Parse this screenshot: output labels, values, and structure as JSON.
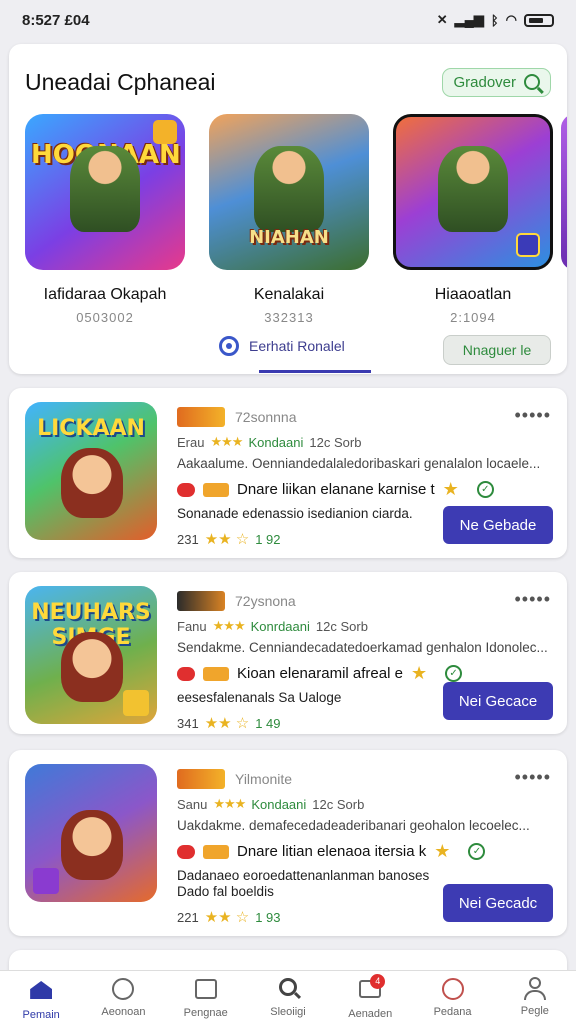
{
  "status": {
    "time": "8:527 £04"
  },
  "featured": {
    "title": "Uneadai Cphaneai",
    "discover_label": "Gradover",
    "items": [
      {
        "name": "Iafidaraa Okapah",
        "count": "0503002",
        "art_text": "HOONAAN"
      },
      {
        "name": "Kenalakai",
        "count": "332313",
        "art_text": "NIAHAN"
      },
      {
        "name": "Hiaaoatlan",
        "count": "2:1094",
        "art_text": ""
      }
    ],
    "footer_tab_label": "Eerhati Ronalel",
    "manage_label": "Nnaguer le"
  },
  "list": [
    {
      "art_text": "LICKAAN",
      "developer": "72sonnna",
      "row2_prefix": "Erau",
      "row2_stars": "★★★",
      "row2_category": "Kondaani",
      "row2_suffix": "12c Sorb",
      "description": "Aakaalume. Oenniandedalaledoribaskari genalalon locaele...",
      "feature_title": "Dnare liikan elanane karnise t",
      "description2": "Sonanade edenassio isedianion ciarda.",
      "rating_prefix": "231",
      "rating_stars": "★★ ☆",
      "rating_suffix": "1 92",
      "install_label": "Ne Gebade"
    },
    {
      "art_text": "NEUHARS SIMGE",
      "developer": "72ysnona",
      "row2_prefix": "Fanu",
      "row2_stars": "★★★",
      "row2_category": "Konrdaani",
      "row2_suffix": "12c Sorb",
      "description": "Sendakme. Cenniandecadatedoerkamad genhalon Idonolec...",
      "feature_title": "Kioan elenaramil afreal e",
      "description2": "eesesfalenanals Sa Ualoge",
      "rating_prefix": "341",
      "rating_stars": "★★ ☆",
      "rating_suffix": "1 49",
      "install_label": "Nei Gecace"
    },
    {
      "art_text": "",
      "developer": "Yilmonite",
      "row2_prefix": "Sanu",
      "row2_stars": "★★★",
      "row2_category": "Kondaani",
      "row2_suffix": "12c Sorb",
      "description": "Uakdakme. demafecedadeaderibanari geohalon lecoelec...",
      "feature_title": "Dnare litian elenaoa itersia k",
      "description2": "Dadanaeo eoroedattenanlanman banoses Dado fal boeldis",
      "rating_prefix": "221",
      "rating_stars": "★★ ☆",
      "rating_suffix": "1 93",
      "install_label": "Nei Gecadc"
    }
  ],
  "nav": [
    {
      "label": "Pemain",
      "active": true
    },
    {
      "label": "Aeonoan"
    },
    {
      "label": "Pengnae"
    },
    {
      "label": "Sleoiigi"
    },
    {
      "label": "Aenaden",
      "badge": "4"
    },
    {
      "label": "Pedana"
    },
    {
      "label": "Pegle"
    }
  ]
}
